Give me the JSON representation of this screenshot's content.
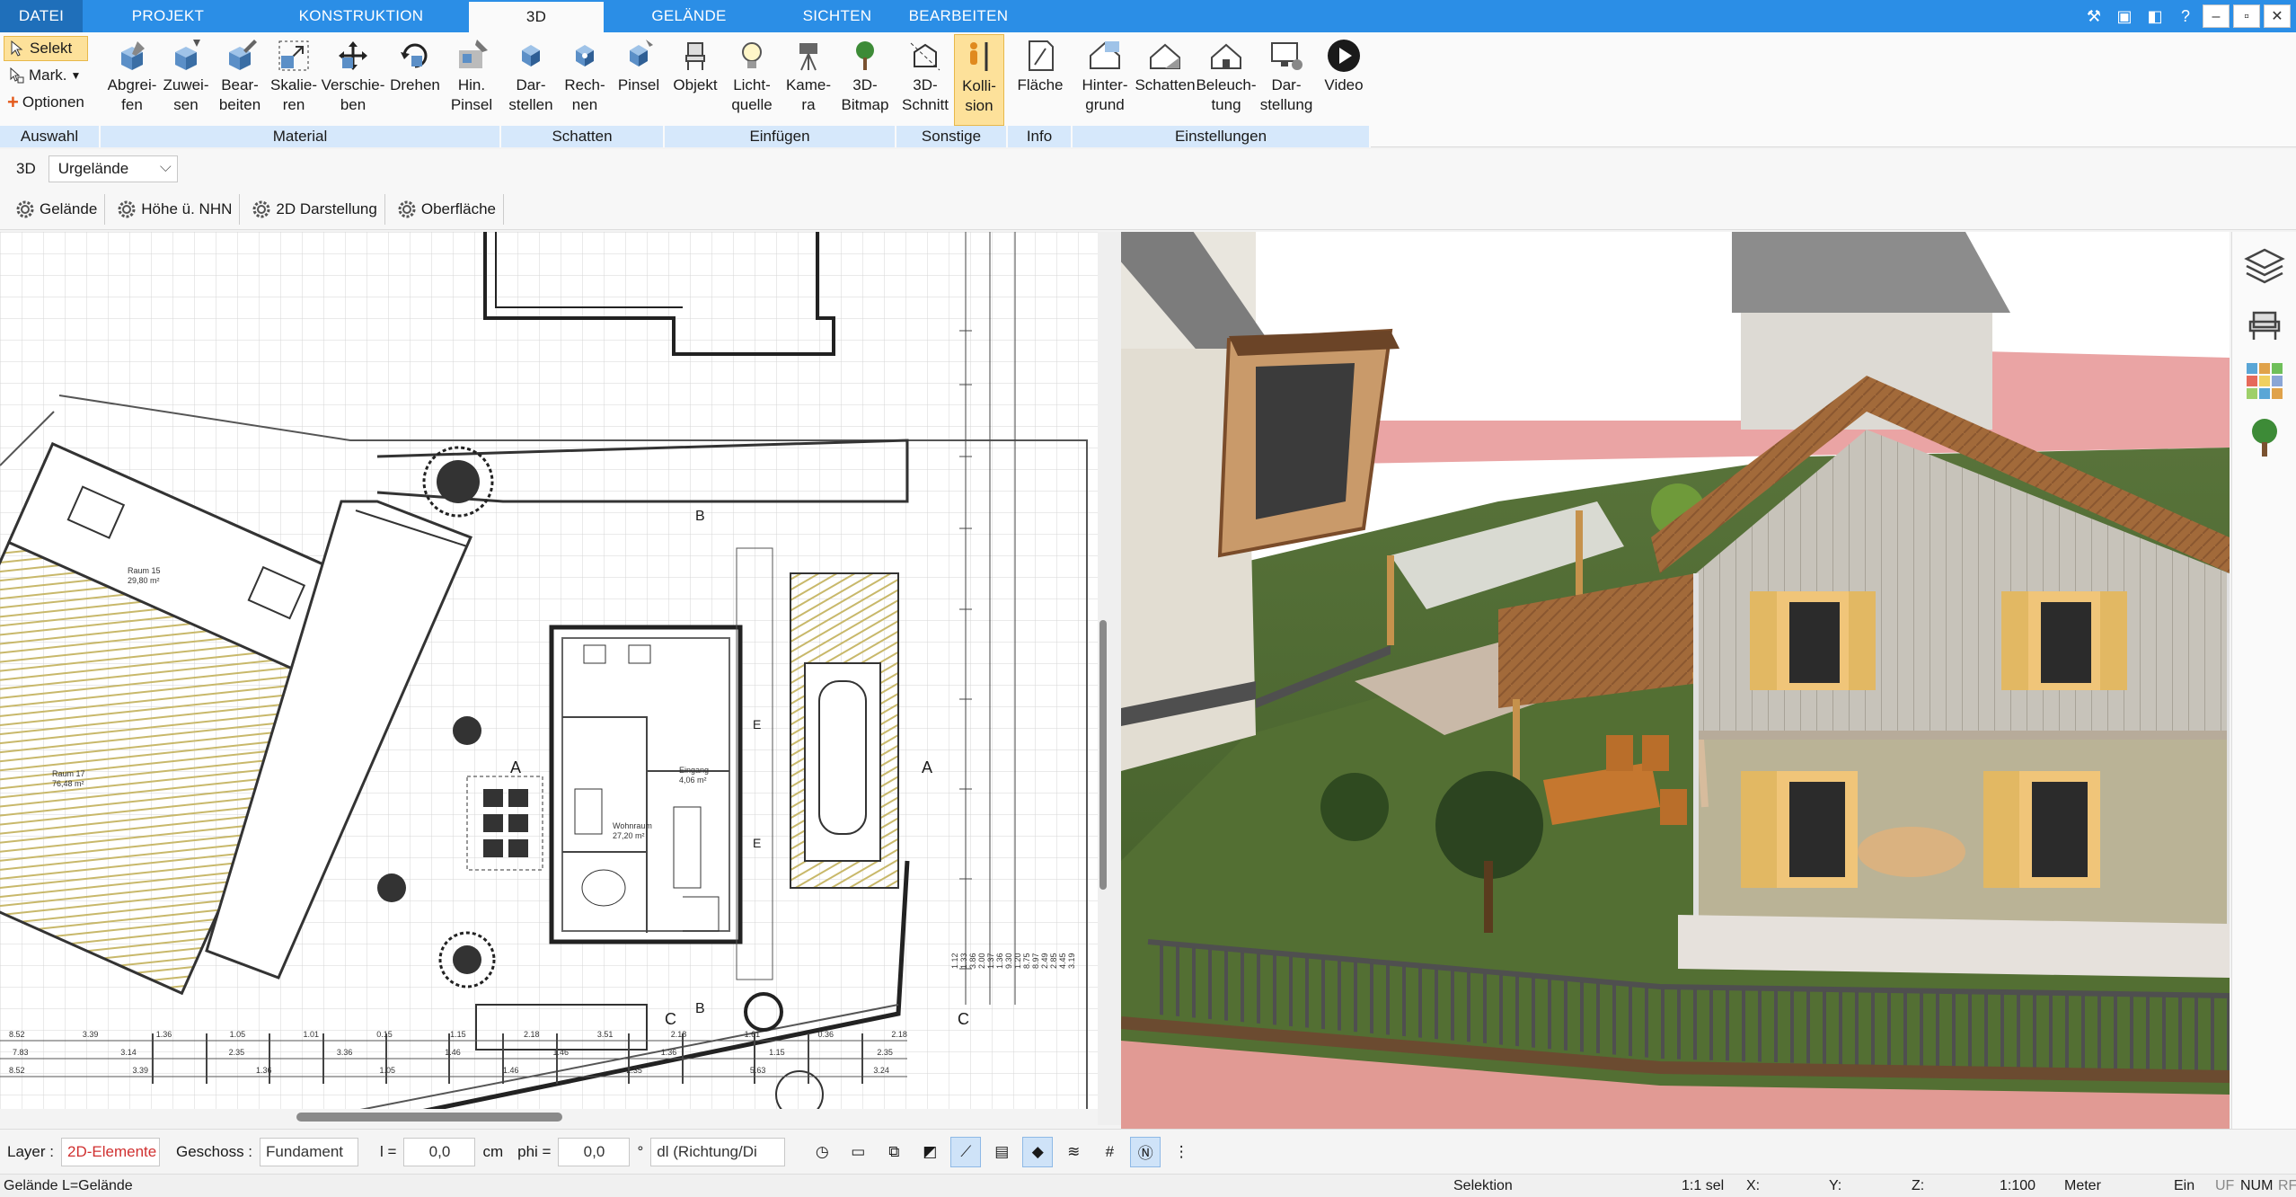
{
  "tabs": [
    "DATEI",
    "PROJEKT",
    "KONSTRUKTION",
    "3D",
    "GELÄNDE",
    "SICHTEN",
    "BEARBEITEN"
  ],
  "ribbon": {
    "auswahl": {
      "label": "Auswahl",
      "selekt": "Selekt",
      "mark": "Mark.",
      "optionen": "Optionen"
    },
    "material": {
      "label": "Material",
      "buttons": [
        "Abgrei-\nfen",
        "Zuwei-\nsen",
        "Bear-\nbeiten",
        "Skalie-\nren",
        "Verschie-\nben",
        "Drehen",
        "Hin.\nPinsel"
      ]
    },
    "schatten": {
      "label": "Schatten",
      "buttons": [
        "Dar-\nstellen",
        "Rech-\nnen",
        "Pinsel"
      ]
    },
    "einfuegen": {
      "label": "Einfügen",
      "buttons": [
        "Objekt",
        "Licht-\nquelle",
        "Kame-\nra",
        "3D-\nBitmap"
      ]
    },
    "sonstige": {
      "label": "Sonstige",
      "buttons": [
        "3D-\nSchnitt",
        "Kolli-\nsion"
      ]
    },
    "info": {
      "label": "Info",
      "buttons": [
        "Fläche"
      ]
    },
    "einstellungen": {
      "label": "Einstellungen",
      "buttons": [
        "Hinter-\ngrund",
        "Schatten",
        "Beleuch-\ntung",
        "Dar-\nstellung",
        "Video"
      ]
    }
  },
  "context": {
    "mode": "3D",
    "dropdown": "Urgelände"
  },
  "propbar": [
    "Gelände",
    "Höhe ü. NHN",
    "2D Darstellung",
    "Oberfläche"
  ],
  "plan": {
    "rooms": [
      {
        "name": "Raum 15",
        "area": "29,80 m²"
      },
      {
        "name": "Raum 17",
        "area": "76,48 m²"
      },
      {
        "name": "Wohnraum",
        "area": "27,20 m²"
      },
      {
        "name": "Eingang",
        "area": "4,06 m²"
      }
    ],
    "section_marks": [
      "A",
      "A",
      "B",
      "B",
      "C",
      "C",
      "E",
      "E"
    ],
    "dims_row1": [
      "8.52",
      "3.39",
      "1.36",
      "1.05",
      "1.01",
      "0.15",
      "1.15",
      "2.18",
      "3.51",
      "2.18",
      "1.61",
      "0.36",
      "2.18"
    ],
    "dims_row2": [
      "7.83",
      "3.14",
      "2.35",
      "3.36",
      "1.46",
      "1.46",
      "1.36",
      "1.15",
      "2.35"
    ],
    "dims_row3": [
      "8.52",
      "3.39",
      "1.36",
      "1.05",
      "1.46",
      "2.35",
      "5.63",
      "3.24"
    ],
    "dims_right": [
      "1.12",
      "1.33",
      "3.86",
      "2.00",
      "1.37",
      "1.36",
      "9.30",
      "1.20",
      "8.75",
      "8.97",
      "2.49",
      "2.85",
      "4.45",
      "3.19"
    ]
  },
  "bottombar": {
    "layer_label": "Layer :",
    "layer_value": "2D-Elemente",
    "geschoss_label": "Geschoss :",
    "geschoss_value": "Fundament",
    "l_label": "l =",
    "l_value": "0,0",
    "l_unit": "cm",
    "phi_label": "phi =",
    "phi_value": "0,0",
    "phi_unit": "°",
    "dl_value": "dl (Richtung/Di"
  },
  "status": {
    "left": "Gelände L=Gelände",
    "mode": "Selektion",
    "sel": "1:1 sel",
    "x": "X:",
    "y": "Y:",
    "z": "Z:",
    "scale": "1:100",
    "unit": "Meter",
    "ein": "Ein",
    "uf": "UF",
    "num": "NUM",
    "rf": "RF"
  },
  "colors": {
    "tabbar": "#2b8ee6",
    "group_label": "#d6e8fb",
    "highlight": "#fde19a",
    "grass": "#4d6a2e",
    "sky": "#ffffff"
  }
}
